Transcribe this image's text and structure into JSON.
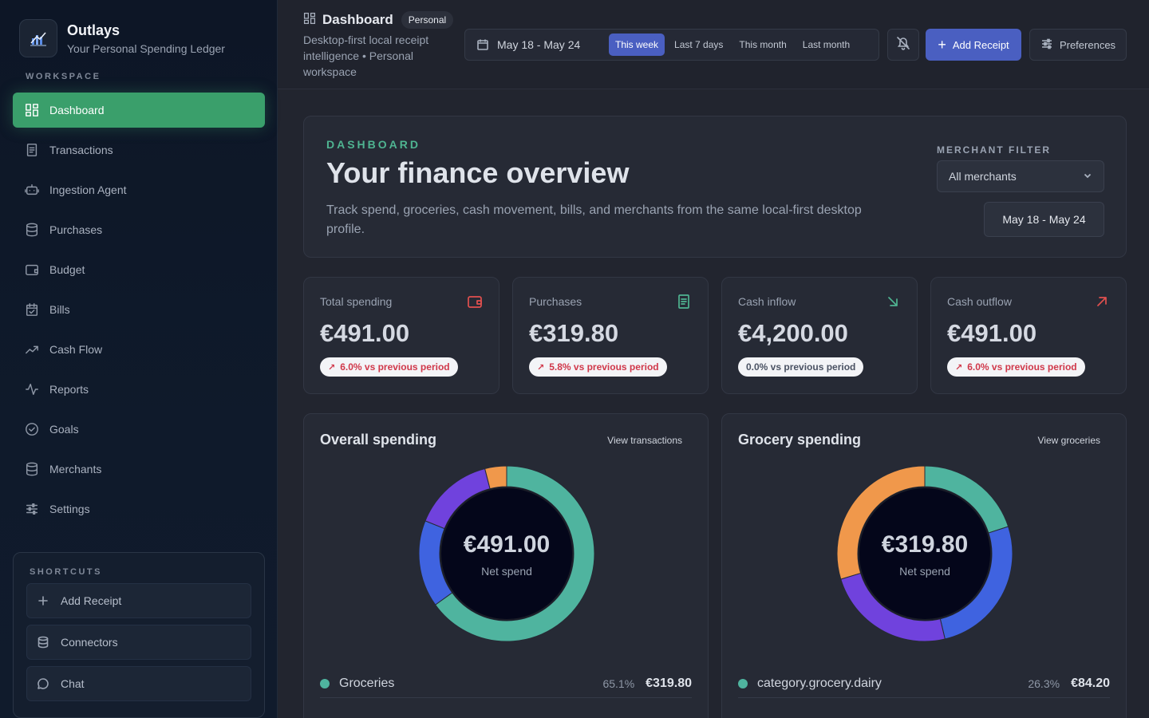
{
  "brand": {
    "title": "Outlays",
    "subtitle": "Your Personal Spending Ledger"
  },
  "sidebar": {
    "section_label": "WORKSPACE",
    "items": [
      {
        "label": "Dashboard",
        "icon": "dashboard-icon",
        "active": true
      },
      {
        "label": "Transactions",
        "icon": "receipt-icon"
      },
      {
        "label": "Ingestion Agent",
        "icon": "robot-icon"
      },
      {
        "label": "Purchases",
        "icon": "database-icon"
      },
      {
        "label": "Budget",
        "icon": "wallet-icon"
      },
      {
        "label": "Bills",
        "icon": "calendar-check-icon"
      },
      {
        "label": "Cash Flow",
        "icon": "trend-up-icon"
      },
      {
        "label": "Reports",
        "icon": "activity-icon"
      },
      {
        "label": "Goals",
        "icon": "check-circle-icon"
      },
      {
        "label": "Merchants",
        "icon": "database-icon"
      },
      {
        "label": "Settings",
        "icon": "sliders-icon"
      }
    ],
    "shortcuts_label": "SHORTCUTS",
    "shortcuts": [
      {
        "label": "Add Receipt",
        "icon": "plus-icon"
      },
      {
        "label": "Connectors",
        "icon": "database-icon"
      },
      {
        "label": "Chat",
        "icon": "chat-bubble-icon"
      }
    ]
  },
  "header": {
    "title": "Dashboard",
    "badge": "Personal",
    "subtitle": "Desktop-first local receipt intelligence • Personal workspace",
    "range": "May 18 - May 24",
    "range_tabs": [
      {
        "label": "This week",
        "active": true
      },
      {
        "label": "Last 7 days"
      },
      {
        "label": "This month"
      },
      {
        "label": "Last month"
      }
    ],
    "add_receipt": "Add Receipt",
    "preferences": "Preferences"
  },
  "hero": {
    "kicker": "DASHBOARD",
    "title": "Your finance overview",
    "description": "Track spend, groceries, cash movement, bills, and merchants from the same local-first desktop profile.",
    "merchant_filter_label": "MERCHANT FILTER",
    "merchant_filter_value": "All merchants",
    "range": "May 18 - May 24"
  },
  "stats": [
    {
      "label": "Total spending",
      "value": "€491.00",
      "delta": "6.0% vs previous period",
      "trend": "up",
      "icon": "wallet-icon",
      "color": "#e2504f"
    },
    {
      "label": "Purchases",
      "value": "€319.80",
      "delta": "5.8% vs previous period",
      "trend": "up",
      "icon": "receipt-icon",
      "color": "#4fb491"
    },
    {
      "label": "Cash inflow",
      "value": "€4,200.00",
      "delta": "0.0% vs previous period",
      "trend": "neutral",
      "icon": "arrow-down-right-icon",
      "color": "#4fb491"
    },
    {
      "label": "Cash outflow",
      "value": "€491.00",
      "delta": "6.0% vs previous period",
      "trend": "up",
      "icon": "arrow-up-right-icon",
      "color": "#e2504f"
    }
  ],
  "panels": [
    {
      "title": "Overall spending",
      "link": "View transactions",
      "center_value": "€491.00",
      "center_label": "Net spend",
      "segments": [
        {
          "value": 65.1,
          "color": "#4fb49f"
        },
        {
          "value": 16.0,
          "color": "#3f63e0"
        },
        {
          "value": 14.9,
          "color": "#7042dd"
        },
        {
          "value": 4.0,
          "color": "#f0984b"
        }
      ],
      "legend": {
        "name": "Groceries",
        "pct": "65.1%",
        "amount": "€319.80",
        "color": "#4fb49f"
      }
    },
    {
      "title": "Grocery spending",
      "link": "View groceries",
      "center_value": "€319.80",
      "center_label": "Net spend",
      "segments": [
        {
          "value": 20.0,
          "color": "#4fb49f"
        },
        {
          "value": 26.3,
          "color": "#3f63e0"
        },
        {
          "value": 24.0,
          "color": "#7042dd"
        },
        {
          "value": 29.7,
          "color": "#f0984b"
        }
      ],
      "legend": {
        "name": "category.grocery.dairy",
        "pct": "26.3%",
        "amount": "€84.20",
        "color": "#4fb49f"
      }
    }
  ]
}
